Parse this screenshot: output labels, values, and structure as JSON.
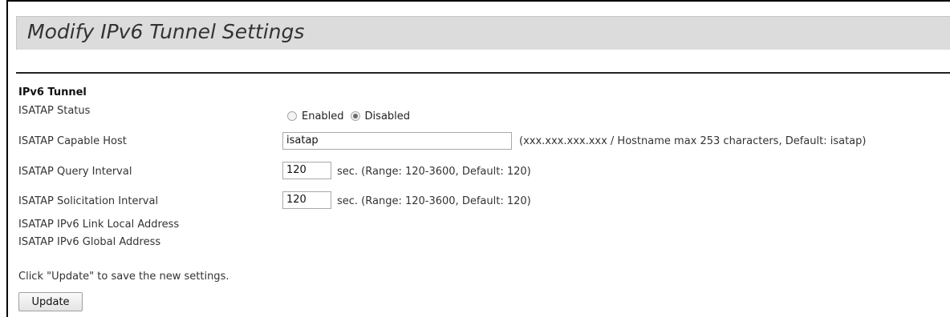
{
  "page": {
    "title": "Modify IPv6 Tunnel Settings"
  },
  "section": {
    "heading": "IPv6 Tunnel"
  },
  "fields": {
    "status": {
      "label": "ISATAP Status",
      "options": [
        "Enabled",
        "Disabled"
      ],
      "selected": "Disabled"
    },
    "capable_host": {
      "label": "ISATAP Capable Host",
      "value": "isatap",
      "hint": "(xxx.xxx.xxx.xxx / Hostname max 253 characters, Default: isatap)"
    },
    "query_interval": {
      "label": "ISATAP Query Interval",
      "value": "120",
      "hint": "sec. (Range: 120-3600, Default: 120)"
    },
    "solicitation_interval": {
      "label": "ISATAP Solicitation Interval",
      "value": "120",
      "hint": "sec. (Range: 120-3600, Default: 120)"
    },
    "link_local": {
      "label": "ISATAP IPv6 Link Local Address"
    },
    "global": {
      "label": "ISATAP IPv6 Global Address"
    }
  },
  "footer": {
    "instruction": "Click \"Update\" to save the new settings.",
    "update_label": "Update"
  }
}
